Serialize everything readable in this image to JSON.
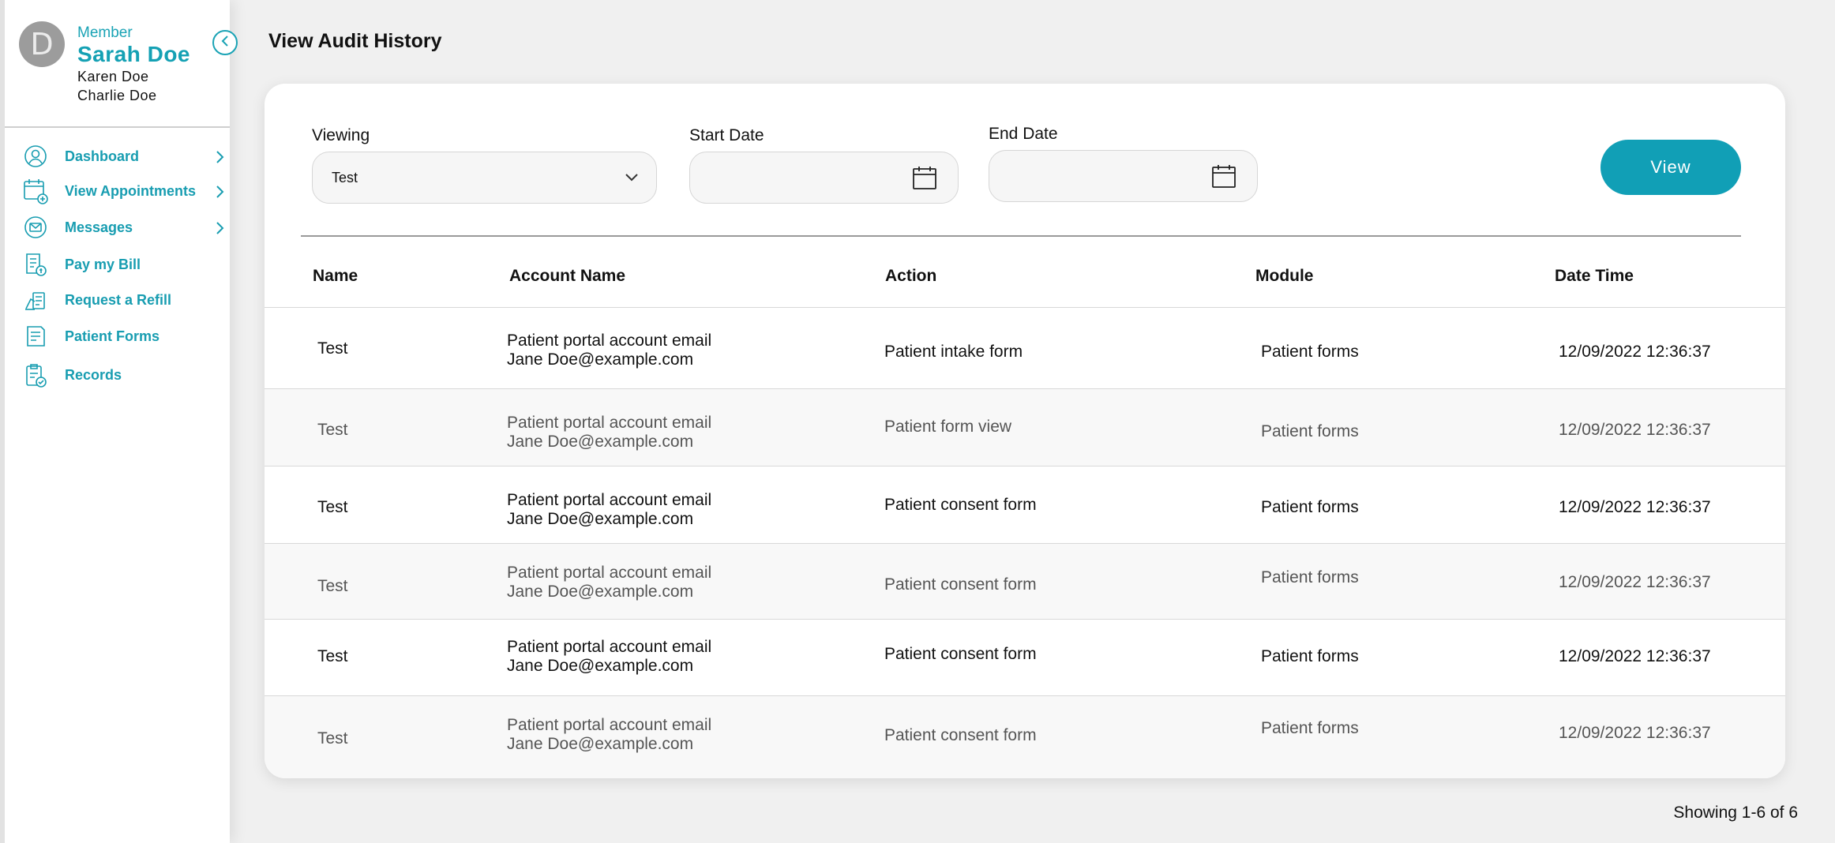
{
  "sidebar": {
    "avatar_initial": "D",
    "member_label": "Member",
    "member_name": "Sarah Doe",
    "dependents": [
      "Karen Doe",
      "Charlie Doe"
    ],
    "nav": [
      {
        "label": "Dashboard",
        "icon": "user-circle-icon",
        "has_chevron": true
      },
      {
        "label": "View Appointments",
        "icon": "calendar-add-icon",
        "has_chevron": true
      },
      {
        "label": "Messages",
        "icon": "envelope-icon",
        "has_chevron": true
      },
      {
        "label": "Pay my Bill",
        "icon": "bill-icon",
        "has_chevron": false
      },
      {
        "label": "Request a Refill",
        "icon": "refill-icon",
        "has_chevron": false
      },
      {
        "label": "Patient Forms",
        "icon": "forms-icon",
        "has_chevron": false
      },
      {
        "label": "Records",
        "icon": "clipboard-check-icon",
        "has_chevron": false
      }
    ]
  },
  "header": {
    "title": "View Audit History"
  },
  "filters": {
    "viewing_label": "Viewing",
    "viewing_value": "Test",
    "start_label": "Start Date",
    "end_label": "End Date",
    "view_button": "View"
  },
  "table": {
    "headers": [
      "Name",
      "Account Name",
      "Action",
      "Module",
      "Date Time"
    ],
    "rows": [
      {
        "name": "Test",
        "account_line1": "Patient portal account email",
        "account_line2": "Jane Doe@example.com",
        "action": "Patient intake form",
        "module": "Patient forms",
        "datetime": "12/09/2022 12:36:37"
      },
      {
        "name": "Test",
        "account_line1": "Patient portal account email",
        "account_line2": "Jane Doe@example.com",
        "action": "Patient form view",
        "module": "Patient forms",
        "datetime": "12/09/2022 12:36:37"
      },
      {
        "name": "Test",
        "account_line1": "Patient portal account email",
        "account_line2": "Jane Doe@example.com",
        "action": "Patient consent form",
        "module": "Patient forms",
        "datetime": "12/09/2022 12:36:37"
      },
      {
        "name": "Test",
        "account_line1": "Patient portal account email",
        "account_line2": "Jane Doe@example.com",
        "action": "Patient consent form",
        "module": "Patient forms",
        "datetime": "12/09/2022 12:36:37"
      },
      {
        "name": "Test",
        "account_line1": "Patient portal account email",
        "account_line2": "Jane Doe@example.com",
        "action": "Patient consent form",
        "module": "Patient forms",
        "datetime": "12/09/2022 12:36:37"
      },
      {
        "name": "Test",
        "account_line1": "Patient portal account email",
        "account_line2": "Jane Doe@example.com",
        "action": "Patient consent form",
        "module": "Patient forms",
        "datetime": "12/09/2022 12:36:37"
      }
    ]
  },
  "pagination": {
    "text": "Showing 1-6 of 6"
  },
  "colors": {
    "accent": "#119fb6",
    "text": "#111111",
    "muted": "#555555"
  }
}
